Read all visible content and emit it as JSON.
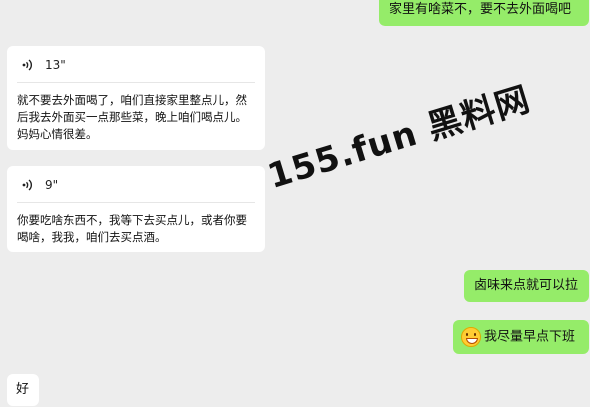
{
  "messages": {
    "sent_top": "家里有啥菜不，要不去外面喝吧",
    "voice1": {
      "duration": "13\"",
      "transcript": "就不要去外面喝了，咱们直接家里整点儿，然后我去外面买一点那些菜，晚上咱们喝点儿。妈妈心情很差。"
    },
    "voice2": {
      "duration": "9\"",
      "transcript": "你要吃啥东西不，我等下去买点儿，或者你要喝啥，我我，咱们去买点酒。"
    },
    "sent_lu": "卤味来点就可以拉",
    "sent_early": "我尽量早点下班",
    "recv_hao": "好"
  },
  "watermark": {
    "text": "155.fun 黑料网"
  },
  "colors": {
    "sent_bubble": "#95ec69",
    "received_bubble": "#ffffff",
    "background": "#ededed"
  },
  "icons": {
    "voice": "voice-wave-icon",
    "emoji": "grinning-face-icon"
  }
}
